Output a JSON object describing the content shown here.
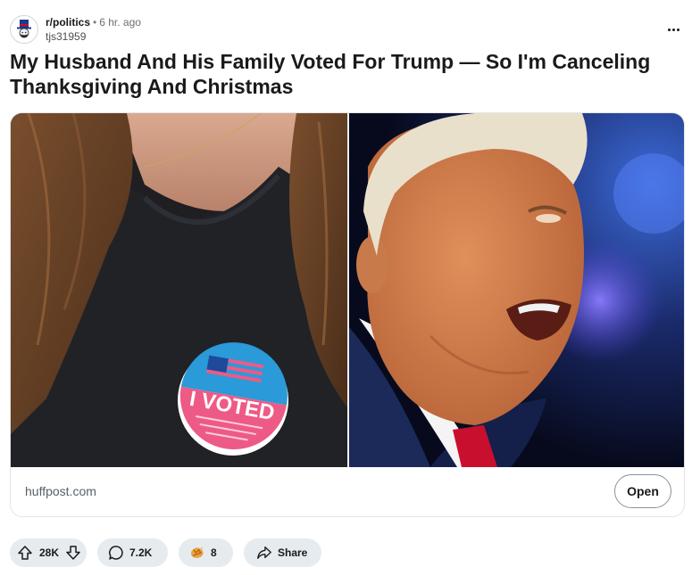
{
  "post": {
    "subreddit": "r/politics",
    "separator": "•",
    "time_ago": "6 hr. ago",
    "username": "tjs31959",
    "title": "My Husband And His Family Voted For Trump — So I'm Canceling Thanksgiving And Christmas"
  },
  "thumbnail": {
    "sticker_text": "I VOTED"
  },
  "link_card": {
    "domain": "huffpost.com",
    "open_label": "Open"
  },
  "actions": {
    "votes": "28K",
    "comments": "7.2K",
    "awards": "8",
    "share_label": "Share"
  },
  "colors": {
    "pill_bg": "#e5ebee",
    "text": "#1a1a1b",
    "muted": "#576069",
    "award": "#e8a33c"
  },
  "icons": {
    "avatar": "subreddit-avatar-icon",
    "more": "more-options-icon",
    "upvote": "upvote-arrow-icon",
    "downvote": "downvote-arrow-icon",
    "comment": "comment-bubble-icon",
    "award": "award-icon",
    "share": "share-arrow-icon"
  }
}
